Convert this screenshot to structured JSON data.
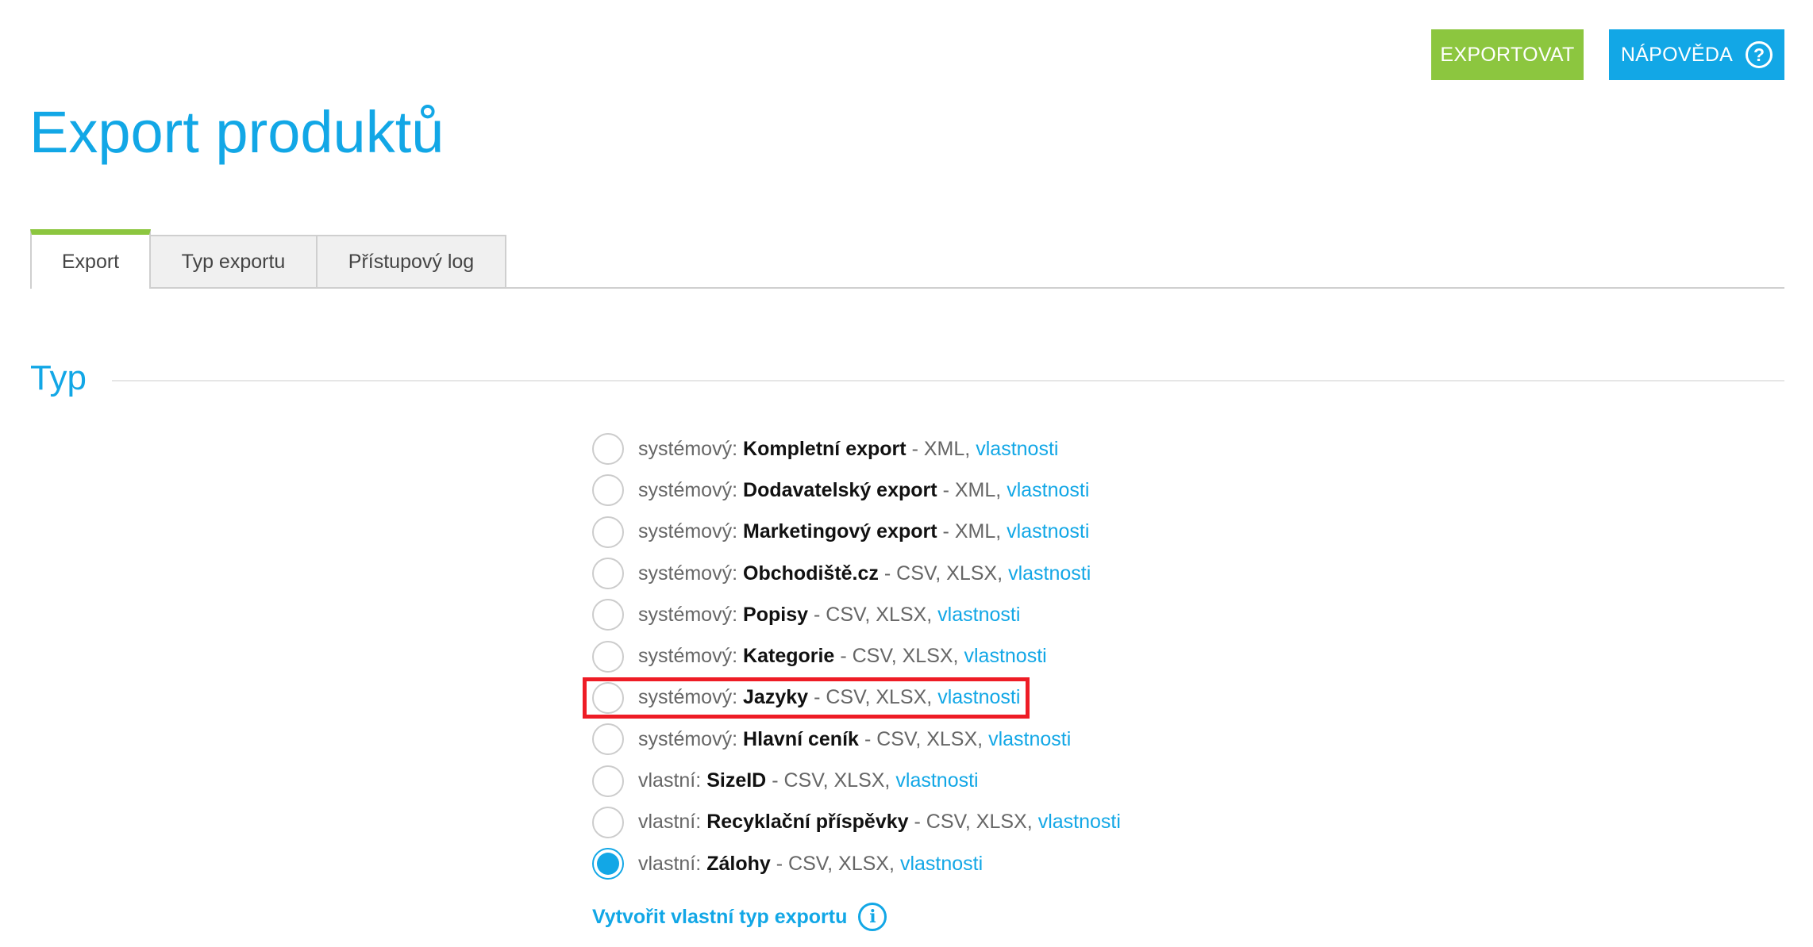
{
  "header": {
    "export_button": "EXPORTOVAT",
    "help_button": "NÁPOVĚDA",
    "help_icon_glyph": "?"
  },
  "page": {
    "title": "Export produktů"
  },
  "tabs": [
    {
      "label": "Export",
      "active": true
    },
    {
      "label": "Typ exportu",
      "active": false
    },
    {
      "label": "Přístupový log",
      "active": false
    }
  ],
  "section": {
    "title": "Typ"
  },
  "options": [
    {
      "prefix": "systémový:",
      "name": "Kompletní export",
      "formats": "- XML,",
      "link": "vlastnosti",
      "checked": false
    },
    {
      "prefix": "systémový:",
      "name": "Dodavatelský export",
      "formats": "- XML,",
      "link": "vlastnosti",
      "checked": false
    },
    {
      "prefix": "systémový:",
      "name": "Marketingový export",
      "formats": "- XML,",
      "link": "vlastnosti",
      "checked": false
    },
    {
      "prefix": "systémový:",
      "name": "Obchodiště.cz",
      "formats": "- CSV, XLSX,",
      "link": "vlastnosti",
      "checked": false
    },
    {
      "prefix": "systémový:",
      "name": "Popisy",
      "formats": "- CSV, XLSX,",
      "link": "vlastnosti",
      "checked": false
    },
    {
      "prefix": "systémový:",
      "name": "Kategorie",
      "formats": "- CSV, XLSX,",
      "link": "vlastnosti",
      "checked": false
    },
    {
      "prefix": "systémový:",
      "name": "Jazyky",
      "formats": "- CSV, XLSX,",
      "link": "vlastnosti",
      "checked": false
    },
    {
      "prefix": "systémový:",
      "name": "Hlavní ceník",
      "formats": "- CSV, XLSX,",
      "link": "vlastnosti",
      "checked": false
    },
    {
      "prefix": "vlastní:",
      "name": "SizeID",
      "formats": "- CSV, XLSX,",
      "link": "vlastnosti",
      "checked": false
    },
    {
      "prefix": "vlastní:",
      "name": "Recyklační příspěvky",
      "formats": "- CSV, XLSX,",
      "link": "vlastnosti",
      "checked": false
    },
    {
      "prefix": "vlastní:",
      "name": "Zálohy",
      "formats": "- CSV, XLSX,",
      "link": "vlastnosti",
      "checked": true
    }
  ],
  "create_link": {
    "label": "Vytvořit vlastní typ exportu",
    "info_glyph": "i"
  },
  "colors": {
    "accent_blue": "#12a7e6",
    "accent_green": "#8cc63f",
    "highlight_red": "#ee1c25"
  }
}
